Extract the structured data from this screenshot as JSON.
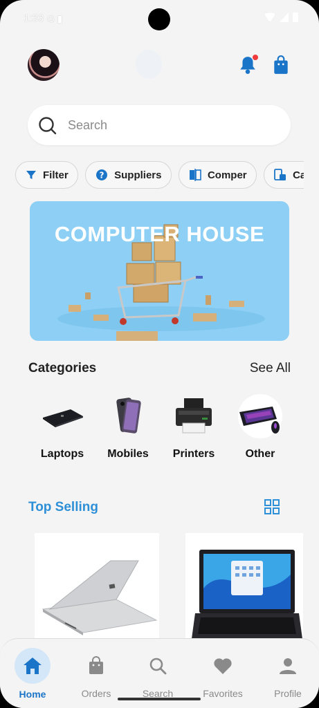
{
  "status": {
    "time": "1:33",
    "left_icons": "G ▮"
  },
  "header": {
    "avatar": "profile-avatar",
    "notification_icon": "bell-icon",
    "cart_icon": "shopping-bag-icon"
  },
  "search": {
    "placeholder": "Search"
  },
  "chips": [
    {
      "label": "Filter",
      "icon": "filter-icon"
    },
    {
      "label": "Suppliers",
      "icon": "question-icon"
    },
    {
      "label": "Comper",
      "icon": "compare-icon"
    },
    {
      "label": "Cate",
      "icon": "category-icon"
    }
  ],
  "banner": {
    "title": "COMPUTER HOUSE"
  },
  "categories": {
    "title": "Categories",
    "see_all": "See All",
    "items": [
      {
        "label": "Laptops"
      },
      {
        "label": "Mobiles"
      },
      {
        "label": "Printers"
      },
      {
        "label": "Other"
      }
    ]
  },
  "top_selling": {
    "title": "Top Selling",
    "view_icon": "grid-view-icon"
  },
  "bottom_nav": [
    {
      "label": "Home",
      "icon": "home-icon",
      "active": true
    },
    {
      "label": "Orders",
      "icon": "bag-icon",
      "active": false
    },
    {
      "label": "Search",
      "icon": "search-icon",
      "active": false
    },
    {
      "label": "Favorites",
      "icon": "heart-icon",
      "active": false
    },
    {
      "label": "Profile",
      "icon": "person-icon",
      "active": false
    }
  ],
  "colors": {
    "accent": "#2d8fd7",
    "nav_active": "#1a74c7",
    "banner_bg": "#8ed0f5",
    "badge": "#ef3b3b"
  }
}
